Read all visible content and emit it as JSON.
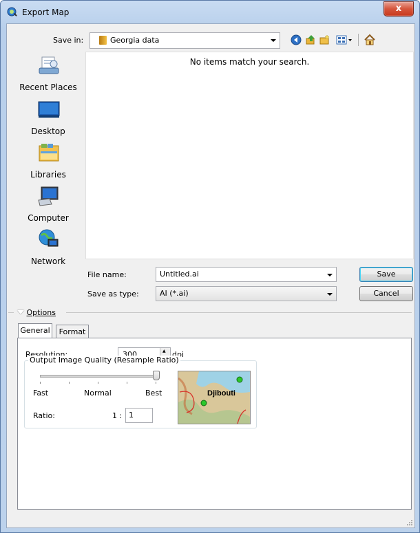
{
  "window": {
    "title": "Export Map",
    "close_label": "x"
  },
  "save_in": {
    "label": "Save in:",
    "value": "Georgia data"
  },
  "places": [
    {
      "label": "Recent Places",
      "icon": "recent-places-icon"
    },
    {
      "label": "Desktop",
      "icon": "desktop-icon"
    },
    {
      "label": "Libraries",
      "icon": "libraries-icon"
    },
    {
      "label": "Computer",
      "icon": "computer-icon"
    },
    {
      "label": "Network",
      "icon": "network-icon"
    }
  ],
  "file_list": {
    "empty_message": "No items match your search."
  },
  "file_name": {
    "label": "File name:",
    "value": "Untitled.ai"
  },
  "save_as_type": {
    "label": "Save as type:",
    "value": "AI (*.ai)"
  },
  "buttons": {
    "save": "Save",
    "cancel": "Cancel"
  },
  "options": {
    "label": "Options"
  },
  "tabs": [
    {
      "label": "General"
    },
    {
      "label": "Format"
    }
  ],
  "general": {
    "resolution_label": "Resolution:",
    "resolution_value": "300",
    "resolution_unit": "dpi",
    "quality_group_title": "Output Image Quality (Resample Ratio)",
    "slider": {
      "labels": [
        "Fast",
        "Normal",
        "Best"
      ],
      "value_fraction": 1.0
    },
    "ratio_label": "Ratio:",
    "ratio_prefix": "1 :",
    "ratio_value": "1",
    "preview_label": "Djibouti"
  },
  "colors": {
    "accent": "#3c7fb1",
    "title_bar": "#c9dcf2",
    "close": "#c8391d"
  }
}
